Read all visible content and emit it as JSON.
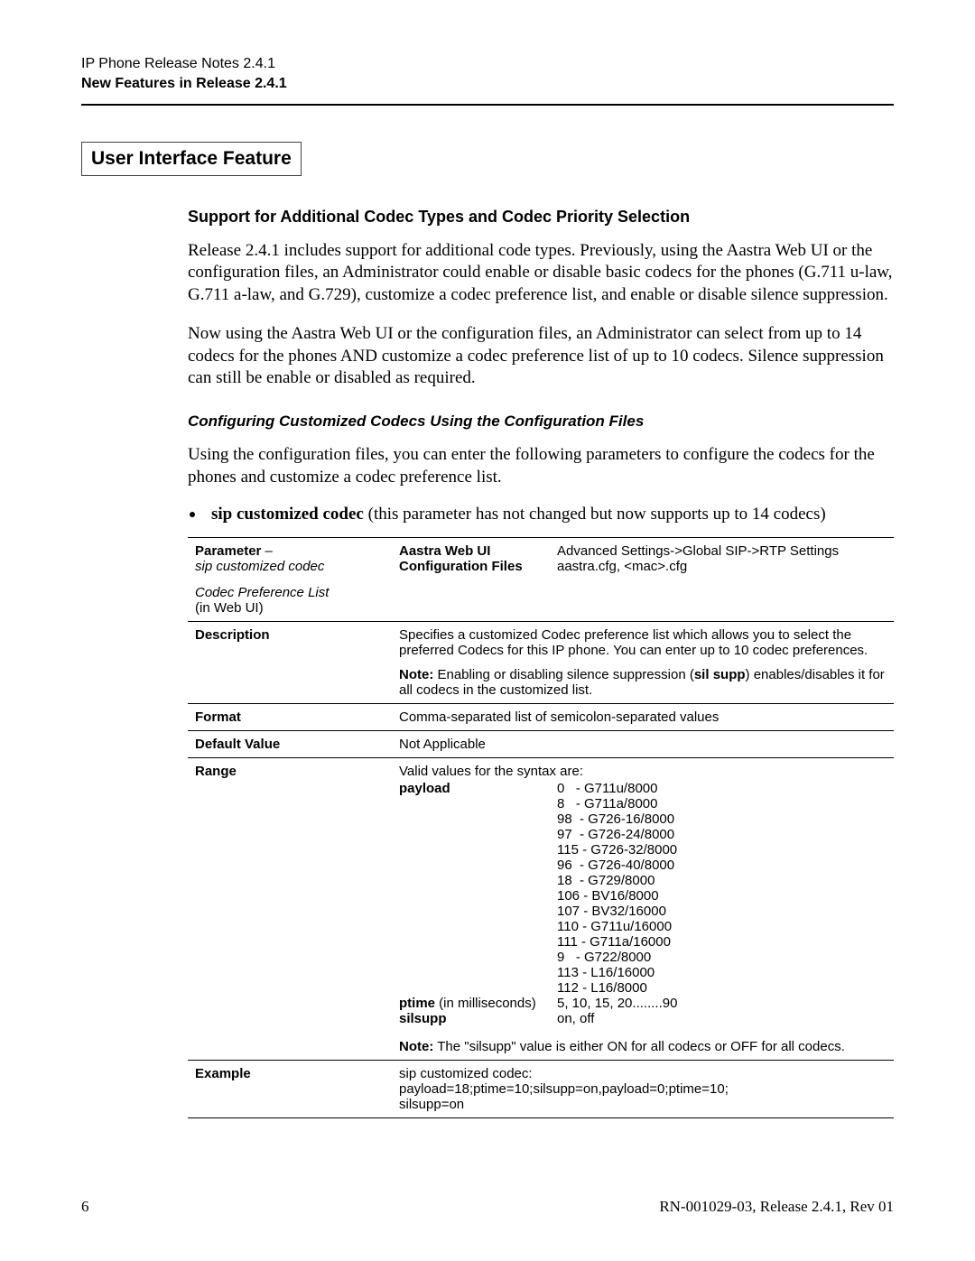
{
  "header": {
    "line1": "IP Phone Release Notes 2.4.1",
    "line2": "New Features in Release 2.4.1"
  },
  "section_title": "User Interface Feature",
  "h2": "Support for Additional Codec Types and Codec Priority Selection",
  "para1": "Release 2.4.1 includes support for additional code types. Previously, using the Aastra Web UI or the configuration files, an Administrator could enable or disable basic codecs for the phones (G.711 u-law, G.711 a-law, and G.729), customize a codec preference list, and enable or disable silence suppression.",
  "para2": "Now using the Aastra Web UI or the configuration files, an Administrator can select from up to 14 codecs for the phones AND customize a codec preference list of up to 10 codecs. Silence suppression can still be enable or disabled as required.",
  "h3": "Configuring Customized Codecs Using the Configuration Files",
  "para3": "Using the configuration files, you can enter the following parameters to configure the codecs for the phones and customize a codec preference list.",
  "bullet": {
    "strong": "sip customized codec",
    "rest": " (this parameter has not changed but now supports up to 14 codecs)"
  },
  "table": {
    "row1": {
      "param_label": "Parameter",
      "dash": " –",
      "param_name": "sip customized codec",
      "sub_label_1": "Codec Preference List",
      "sub_label_2": "(in Web UI)",
      "k1": "Aastra Web UI",
      "v1": "Advanced Settings->Global SIP->RTP Settings",
      "k2": "Configuration Files",
      "v2": "aastra.cfg, <mac>.cfg"
    },
    "row_desc": {
      "label": "Description",
      "text": "Specifies a customized Codec preference list which allows you to select the preferred Codecs for this IP phone. You can enter up to 10 codec preferences.",
      "note_word": "Note:",
      "note_rest": " Enabling or disabling silence suppression (",
      "note_bold2": "sil supp",
      "note_rest2": ") enables/disables it for all codecs in the customized list."
    },
    "row_format": {
      "label": "Format",
      "value": "Comma-separated list of semicolon-separated values"
    },
    "row_default": {
      "label": "Default Value",
      "value": "Not Applicable"
    },
    "row_range": {
      "label": "Range",
      "intro": "Valid values for the syntax are:",
      "payload_label": "payload",
      "payload_values": "0   - G711u/8000\n8   - G711a/8000\n98  - G726-16/8000\n97  - G726-24/8000\n115 - G726-32/8000\n96  - G726-40/8000\n18  - G729/8000\n106 - BV16/8000\n107 - BV32/16000\n110 - G711u/16000\n111 - G711a/16000\n9   - G722/8000\n113 - L16/16000\n112 - L16/8000",
      "ptime_bold": "ptime",
      "ptime_paren": " (in milliseconds)",
      "ptime_values": "5, 10, 15, 20........90",
      "silsupp_label": "silsupp",
      "silsupp_values": "on, off",
      "note_word": "Note:",
      "note_rest": " The \"silsupp\" value is either ON for all codecs or OFF for all codecs."
    },
    "row_example": {
      "label": "Example",
      "l1": "sip customized codec:",
      "l2": "payload=18;ptime=10;silsupp=on,payload=0;ptime=10;",
      "l3": "silsupp=on"
    }
  },
  "footer": {
    "page": "6",
    "doc": "RN-001029-03, Release 2.4.1, Rev 01"
  }
}
